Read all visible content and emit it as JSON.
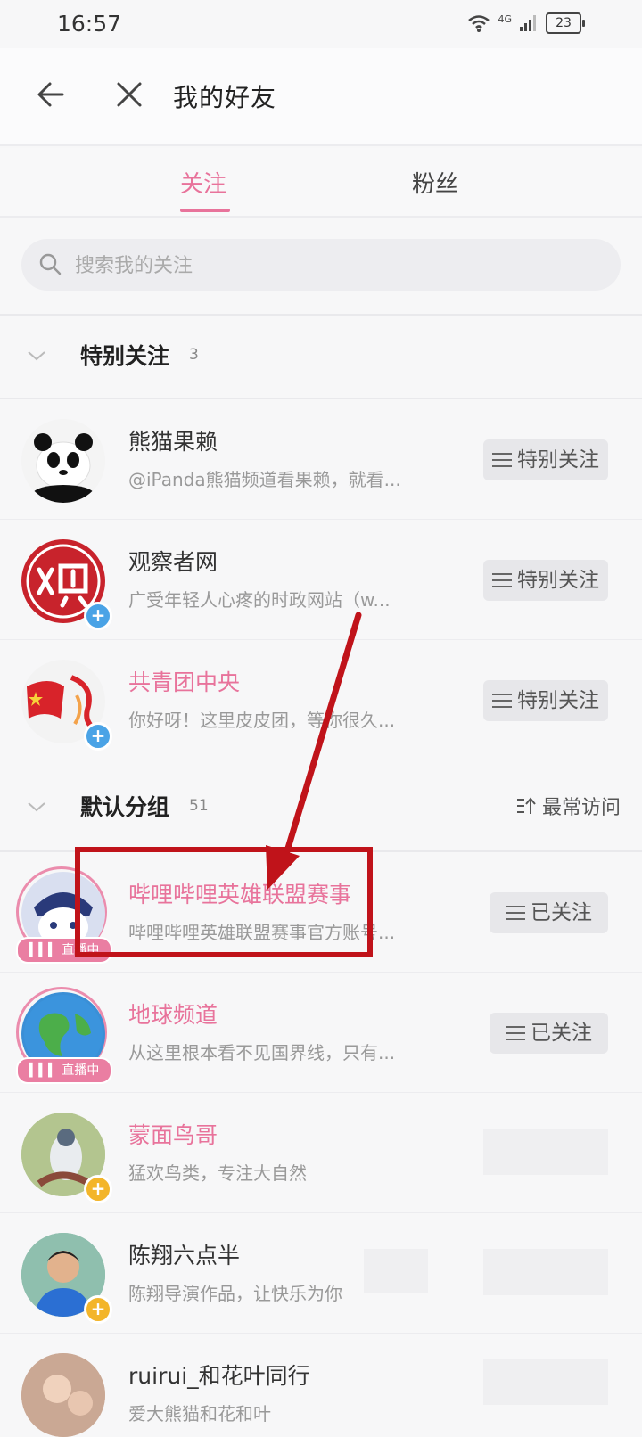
{
  "status_bar": {
    "time": "16:57",
    "network": "4G",
    "battery": "23"
  },
  "header": {
    "title": "我的好友"
  },
  "tabs": [
    {
      "label": "关注"
    },
    {
      "label": "粉丝"
    }
  ],
  "search": {
    "placeholder": "搜索我的关注"
  },
  "special_group": {
    "name": "特别关注",
    "count": "3",
    "items": [
      {
        "name": "熊猫果赖",
        "desc": "@iPanda熊猫频道看果赖，就看...",
        "button": "特别关注"
      },
      {
        "name": "观察者网",
        "desc": "广受年轻人心疼的时政网站（w...",
        "button": "特别关注"
      },
      {
        "name": "共青团中央",
        "desc": "你好呀！这里皮皮团，等你很久...",
        "button": "特别关注"
      }
    ]
  },
  "default_group": {
    "name": "默认分组",
    "count": "51",
    "sort_label": "最常访问",
    "items": [
      {
        "name": "哔哩哔哩英雄联盟赛事",
        "desc": "哔哩哔哩英雄联盟赛事官方账号...",
        "button": "已关注",
        "live": "直播中"
      },
      {
        "name": "地球频道",
        "desc": "从这里根本看不见国界线，只有...",
        "button": "已关注",
        "live": "直播中"
      },
      {
        "name": "蒙面鸟哥",
        "desc": "猛欢鸟类，专注大自然"
      },
      {
        "name": "陈翔六点半",
        "desc": "陈翔导演作品，让快乐为你"
      },
      {
        "name": "ruirui_和花叶同行",
        "desc": "爱大熊猫和花和叶"
      }
    ]
  },
  "colors": {
    "accent": "#e8739b",
    "annotation": "#c0131a"
  }
}
